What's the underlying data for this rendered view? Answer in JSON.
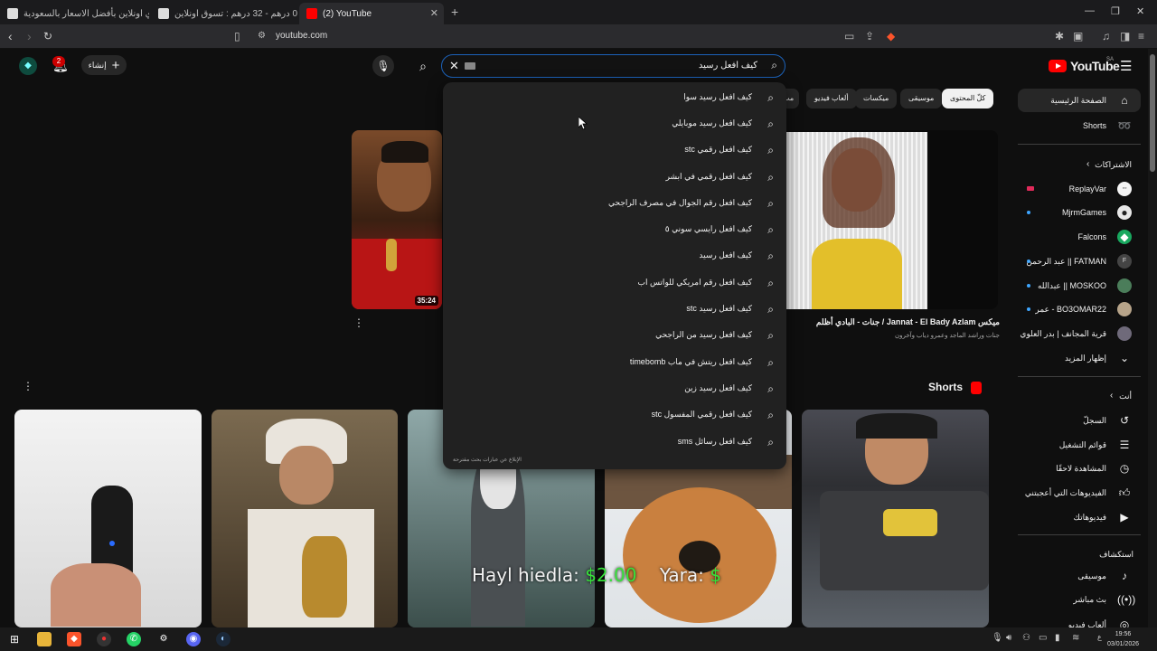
{
  "browser": {
    "tabs": [
      {
        "title": "اشتري اونلاين بأفضل الاسعار بالسعودية"
      },
      {
        "title": "مايك - 0 درهم - 32 درهم : تسوق اونلاين"
      },
      {
        "title": "(2) YouTube"
      }
    ],
    "url": "youtube.com"
  },
  "header": {
    "logo_text": "YouTube",
    "region": "SA",
    "search_value": "كيف افعل رسيد",
    "create_label": "إنشاء",
    "notifications_count": "2"
  },
  "chips": [
    "كلّ المحتوى",
    "موسيقى",
    "ميكسات",
    "ألعاب فيديو",
    "مب"
  ],
  "suggestions": [
    "كيف افعل رسيد سوا",
    "كيف افعل رسيد موبايلي",
    "كيف افعل رقمي stc",
    "كيف افعل رقمي في ابشر",
    "كيف افعل رقم الجوال في مصرف الراجحي",
    "كيف افعل رايسي سوني ٥",
    "كيف افعل رسيد",
    "كيف افعل رقم امريكي للواتس اب",
    "كيف افعل رسيد stc",
    "كيف افعل رسيد من الراجحي",
    "كيف افعل ريتش في ماب timebomb",
    "كيف افعل رسيد زين",
    "كيف افعل رقمي المفسول stc",
    "كيف افعل رسائل sms"
  ],
  "report_link": "الإبلاغ عن عبارات بحث مقترحة",
  "video": {
    "duration": "35:24",
    "title": "ميكس Jannat - El Bady Azlam / جنات - البادي أظلم",
    "channel": "جنات وراشد الماجد وعمرو دياب وآخرون"
  },
  "shorts_title": "Shorts",
  "sidebar": {
    "home": "الصفحة الرئيسية",
    "shorts": "Shorts",
    "subs_header": "الاشتراكات",
    "channels": [
      {
        "name": "ReplayVar"
      },
      {
        "name": "MjrmGames"
      },
      {
        "name": "Falcons"
      },
      {
        "name": "FATMAN || عبد الرحمن"
      },
      {
        "name": "MOSKOO || عبدالله"
      },
      {
        "name": "BO3OMAR22 - عمر"
      },
      {
        "name": "قرية المجانف | بدر العلوي"
      }
    ],
    "show_more": "إظهار المزيد",
    "you_header": "أنت",
    "you_items": [
      "السجلّ",
      "قوائم التشغيل",
      "المشاهدة لاحقًا",
      "الفيديوهات التي أعجبتني",
      "فيديوهاتك"
    ],
    "explore_header": "استكشاف",
    "explore_items": [
      "موسيقى",
      "بث مباشر",
      "ألعاب فيديو"
    ]
  },
  "overlay_caption": {
    "name1": "Hayl hiedla:",
    "amount1": "$2.00",
    "name2": "Yara:",
    "amount2": "$"
  },
  "taskbar": {
    "time": "19:56",
    "date": "03/01/2026"
  },
  "colors": {
    "background": "#0f0f0f",
    "dropdown": "#212121",
    "accent_red": "#ff0000",
    "money_green": "#37e23a"
  }
}
